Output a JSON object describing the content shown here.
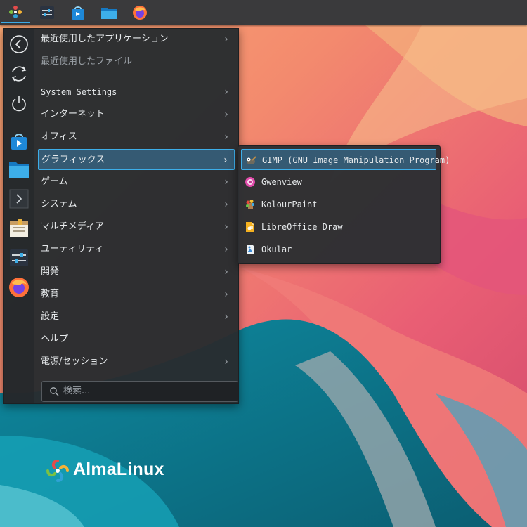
{
  "menu": {
    "categories": [
      {
        "label": "最近使用したアプリケーション",
        "arrow": true,
        "dim": false
      },
      {
        "label": "最近使用したファイル",
        "arrow": false,
        "dim": true
      },
      {
        "label": "System Settings",
        "arrow": true,
        "dim": false
      },
      {
        "label": "インターネット",
        "arrow": true,
        "dim": false
      },
      {
        "label": "オフィス",
        "arrow": true,
        "dim": false
      },
      {
        "label": "グラフィックス",
        "arrow": true,
        "dim": false,
        "selected": true
      },
      {
        "label": "ゲーム",
        "arrow": true,
        "dim": false
      },
      {
        "label": "システム",
        "arrow": true,
        "dim": false
      },
      {
        "label": "マルチメディア",
        "arrow": true,
        "dim": false
      },
      {
        "label": "ユーティリティ",
        "arrow": true,
        "dim": false
      },
      {
        "label": "開発",
        "arrow": true,
        "dim": false
      },
      {
        "label": "教育",
        "arrow": true,
        "dim": false
      },
      {
        "label": "設定",
        "arrow": true,
        "dim": false
      },
      {
        "label": "ヘルプ",
        "arrow": false,
        "dim": false
      },
      {
        "label": "電源/セッション",
        "arrow": true,
        "dim": false
      }
    ],
    "search_placeholder": "検索..."
  },
  "submenu": {
    "items": [
      {
        "label": "GIMP (GNU Image Manipulation Program)",
        "icon": "gimp-icon",
        "selected": true
      },
      {
        "label": "Gwenview",
        "icon": "gwenview-icon"
      },
      {
        "label": "KolourPaint",
        "icon": "kolourpaint-icon"
      },
      {
        "label": "LibreOffice Draw",
        "icon": "libreoffice-draw-icon"
      },
      {
        "label": "Okular",
        "icon": "okular-icon"
      }
    ]
  },
  "taskbar": {
    "icons": [
      "almalinux-menu-icon",
      "system-settings-icon",
      "discover-store-icon",
      "file-manager-icon",
      "firefox-icon"
    ]
  },
  "sidebar": {
    "icons": [
      "back-icon",
      "restart-icon",
      "power-icon",
      "discover-store-icon",
      "file-manager-icon",
      "terminal-icon",
      "archive-icon",
      "system-settings-icon",
      "firefox-icon"
    ]
  },
  "desktop": {
    "logo_text": "AlmaLinux"
  },
  "colors": {
    "accent": "#3daee9",
    "selection": "#355a73",
    "taskbar": "#3a3a3c"
  }
}
